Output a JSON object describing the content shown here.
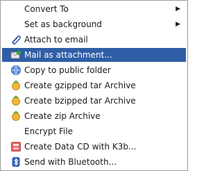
{
  "menu": {
    "items": [
      {
        "label": "Convert To",
        "icon": "",
        "submenu": true
      },
      {
        "label": "Set as background",
        "icon": "",
        "submenu": true
      },
      {
        "label": "Attach to email",
        "icon": "paperclip-icon"
      },
      {
        "label": "Mail as attachment...",
        "icon": "mail-send-icon",
        "selected": true
      },
      {
        "label": "Copy to public folder",
        "icon": "globe-folder-icon"
      },
      {
        "label": "Create gzipped tar Archive",
        "icon": "archive-icon"
      },
      {
        "label": "Create bzipped tar Archive",
        "icon": "archive-icon"
      },
      {
        "label": "Create zip Archive",
        "icon": "archive-icon"
      },
      {
        "label": "Encrypt File",
        "icon": ""
      },
      {
        "label": "Create Data CD with K3b...",
        "icon": "k3b-cd-icon"
      },
      {
        "label": "Send with Bluetooth...",
        "icon": "bluetooth-icon"
      }
    ],
    "submenu_arrow": "▶",
    "colors": {
      "highlight": "#2f5ea6",
      "highlight_text": "#ffffff",
      "text": "#1a1a1a",
      "border": "#9c9a94"
    }
  }
}
